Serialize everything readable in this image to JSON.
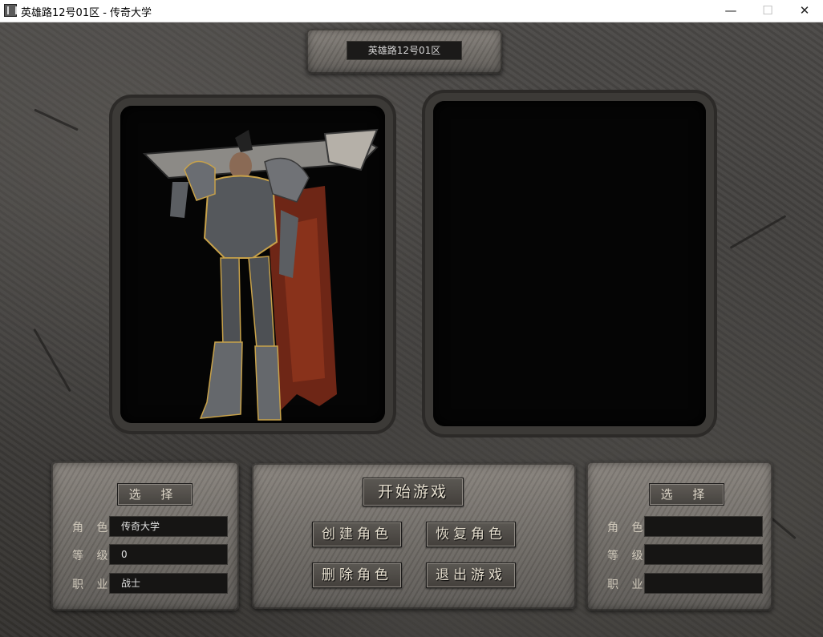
{
  "window": {
    "title": "英雄路12号01区 - 传奇大学",
    "minimize": "—",
    "maximize": "☐",
    "close": "✕"
  },
  "server": {
    "name": "英雄路12号01区"
  },
  "left_slot": {
    "select_label": "选 择",
    "labels": {
      "role": "角 色",
      "level": "等 级",
      "job": "职 业"
    },
    "role_value": "传奇大学",
    "level_value": "0",
    "job_value": "战士"
  },
  "right_slot": {
    "select_label": "选 择",
    "labels": {
      "role": "角 色",
      "level": "等 级",
      "job": "职 业"
    },
    "role_value": "",
    "level_value": "",
    "job_value": ""
  },
  "actions": {
    "start": "开始游戏",
    "create": "创建角色",
    "restore": "恢复角色",
    "delete": "删除角色",
    "exit": "退出游戏"
  }
}
